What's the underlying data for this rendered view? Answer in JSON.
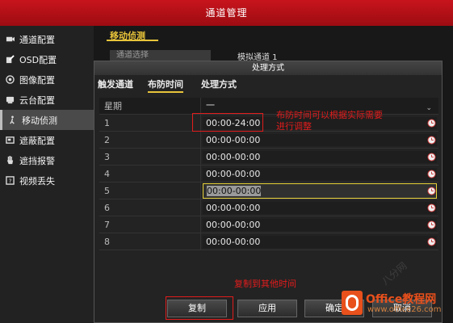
{
  "window": {
    "title": "通道管理"
  },
  "sidebar": {
    "items": [
      {
        "label": "通道配置",
        "icon": "camera-icon"
      },
      {
        "label": "OSD配置",
        "icon": "edit-icon"
      },
      {
        "label": "图像配置",
        "icon": "image-icon"
      },
      {
        "label": "云台配置",
        "icon": "ptz-icon"
      },
      {
        "label": "移动侦测",
        "icon": "motion-icon",
        "active": true
      },
      {
        "label": "遮蔽配置",
        "icon": "mask-icon"
      },
      {
        "label": "遮挡报警",
        "icon": "hand-icon"
      },
      {
        "label": "视频丢失",
        "icon": "video-loss-icon"
      }
    ]
  },
  "main": {
    "tab_label": "移动侦测",
    "channel_select_label": "通道选择",
    "channel_select_value": "模拟通道 1"
  },
  "dialog": {
    "title": "处理方式",
    "tabs": [
      {
        "label": "触发通道"
      },
      {
        "label": "布防时间",
        "active": true
      },
      {
        "label": "处理方式"
      }
    ],
    "week_label": "星期",
    "week_value": "一",
    "schedule": [
      {
        "row": "1",
        "time": "00:00-24:00"
      },
      {
        "row": "2",
        "time": "00:00-00:00"
      },
      {
        "row": "3",
        "time": "00:00-00:00"
      },
      {
        "row": "4",
        "time": "00:00-00:00"
      },
      {
        "row": "5",
        "time": "00:00-00:00",
        "selected": true
      },
      {
        "row": "6",
        "time": "00:00-00:00"
      },
      {
        "row": "7",
        "time": "00:00-00:00"
      },
      {
        "row": "8",
        "time": "00:00-00:00"
      }
    ],
    "buttons": {
      "copy": "复制",
      "apply": "应用",
      "ok": "确定",
      "cancel": "取消"
    }
  },
  "annotations": {
    "time_note_line1": "布防时间可以根据实际需要",
    "time_note_line2": "进行调整",
    "copy_note": "复制到其他时间"
  },
  "brand": {
    "name": "Office教程网",
    "url": "www.office26.com"
  },
  "colors": {
    "titlebar": "#b81018",
    "accent_yellow": "#e8c43a",
    "annotation_red": "#e21c1c",
    "brand_orange": "#e8501c"
  }
}
